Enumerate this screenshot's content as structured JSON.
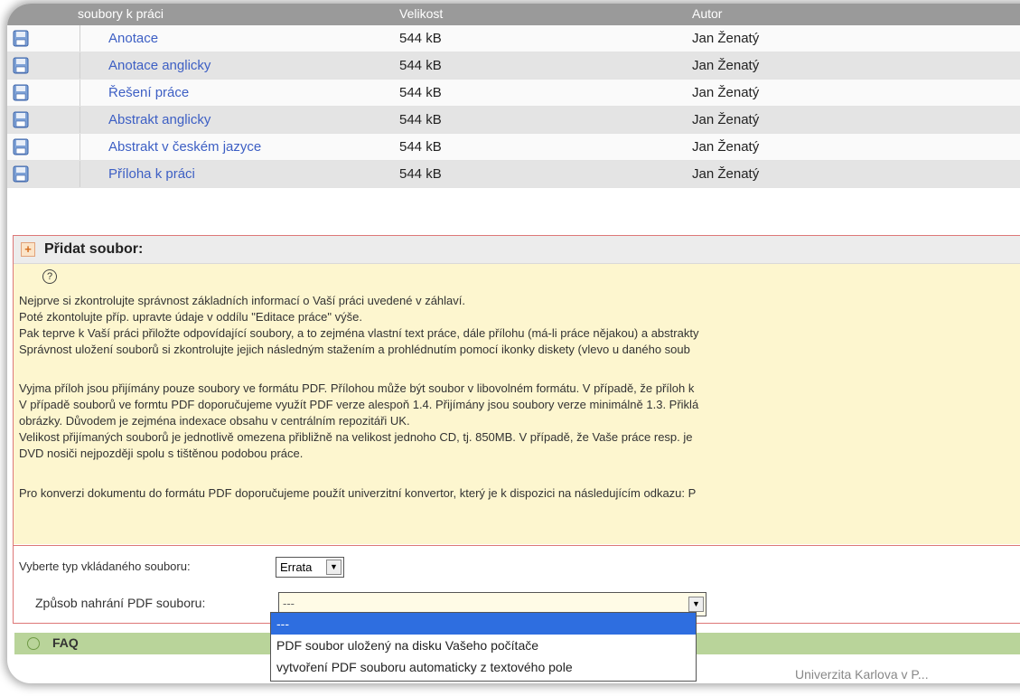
{
  "files_table": {
    "header": {
      "name": "soubory k práci",
      "size": "Velikost",
      "author": "Autor"
    },
    "rows": [
      {
        "name": "Anotace",
        "size": "544 kB",
        "author": "Jan Ženatý"
      },
      {
        "name": "Anotace anglicky",
        "size": "544 kB",
        "author": "Jan Ženatý"
      },
      {
        "name": "Řešení práce",
        "size": "544 kB",
        "author": "Jan Ženatý"
      },
      {
        "name": "Abstrakt anglicky",
        "size": "544 kB",
        "author": "Jan Ženatý"
      },
      {
        "name": "Abstrakt v českém jazyce",
        "size": "544 kB",
        "author": "Jan Ženatý"
      },
      {
        "name": "Příloha k práci",
        "size": "544 kB",
        "author": "Jan Ženatý"
      }
    ],
    "row_icon": "floppy-disk-icon"
  },
  "add_file": {
    "title": "Přidat soubor:",
    "help_icon": "?",
    "help_lines": [
      "Nejprve si zkontrolujte správnost základních informací o Vaší práci uvedené v záhlaví.",
      "Poté zkontolujte příp. upravte údaje v oddílu \"Editace práce\" výše.",
      "Pak teprve k Vaší práci přiložte odpovídající soubory, a to zejména vlastní text práce, dále přílohu (má-li práce nějakou) a abstrakty",
      "Správnost uložení souborů si zkontrolujte jejich následným stažením a prohlédnutím pomocí ikonky diskety (vlevo u daného soub",
      "Vyjma příloh jsou přijímány pouze soubory ve formátu PDF. Přílohou může být soubor v libovolném formátu. V případě, že příloh k",
      "V případě souborů ve formtu PDF doporučujeme využít PDF verze alespoň 1.4. Přijímány jsou soubory verze minimálně 1.3. Přiklá",
      "obrázky. Důvodem je zejména indexace obsahu v centrálním repozitáři UK.",
      "Velikost přijímaných souborů je jednotlivě omezena přibližně na velikost jednoho CD, tj. 850MB. V případě, že Vaše práce resp. je",
      "DVD nosiči nejpozději spolu s tištěnou podobou práce.",
      "Pro konverzi dokumentu do formátu PDF doporučujeme použít univerzitní konvertor, který je k dispozici na následujícím odkazu: P"
    ],
    "type_label": "Vyberte typ vkládaného souboru:",
    "type_value": "Errata",
    "method_label": "Způsob nahrání PDF souboru:",
    "method_value": "---",
    "method_options": [
      "---",
      "PDF soubor uložený na disku Vašeho počítače",
      "vytvoření PDF souboru automaticky z textového pole"
    ]
  },
  "faq": {
    "label": "FAQ"
  },
  "footer": {
    "text": "Univerzita Karlova v P..."
  }
}
